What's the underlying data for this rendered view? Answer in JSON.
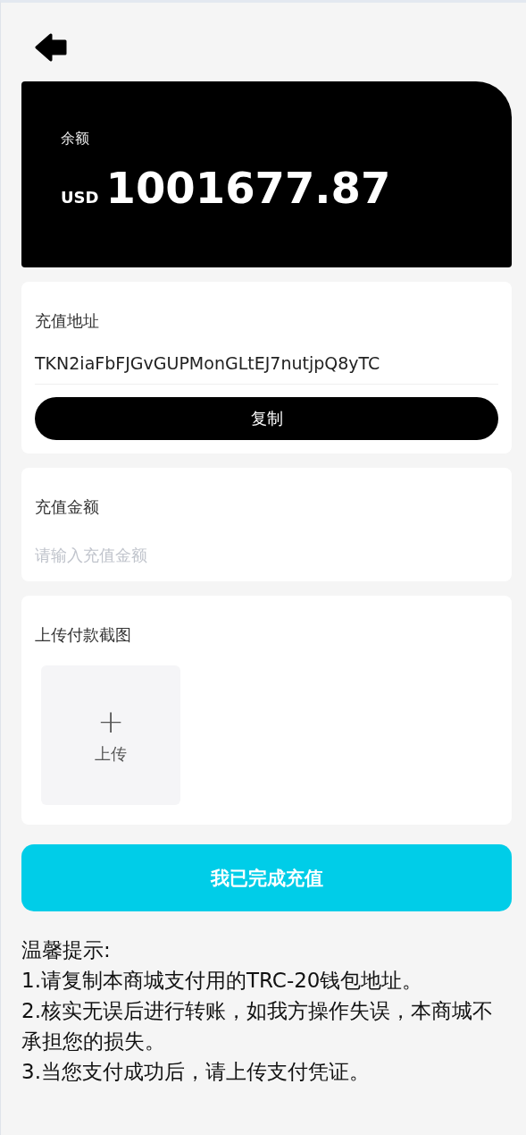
{
  "balance": {
    "label": "余额",
    "currency": "USD",
    "amount": "1001677.87"
  },
  "address": {
    "label": "充值地址",
    "value": "TKN2iaFbFJGvGUPMonGLtEJ7nutjpQ8yTC",
    "copy_button": "复制"
  },
  "amount": {
    "label": "充值金额",
    "placeholder": "请输入充值金额"
  },
  "upload": {
    "label": "上传付款截图",
    "button_icon": "+",
    "button_label": "上传"
  },
  "submit_button": "我已完成充值",
  "tips": [
    "温馨提示:",
    "1.请复制本商城支付用的TRC-20钱包地址。",
    "2.核实无误后进行转账，如我方操作失误，本商城不承担您的损失。",
    "3.当您支付成功后，请上传支付凭证。"
  ]
}
